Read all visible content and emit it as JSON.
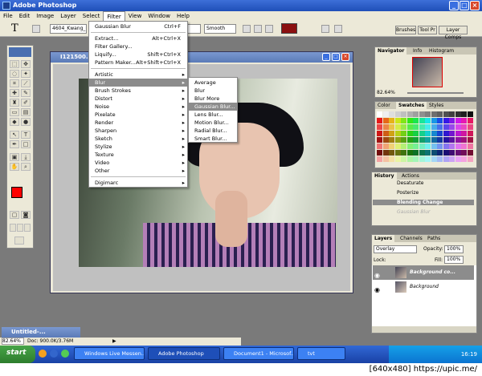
{
  "app_title": "Adobe Photoshop",
  "menu": [
    "File",
    "Edit",
    "Image",
    "Layer",
    "Select",
    "Filter",
    "View",
    "Window",
    "Help"
  ],
  "options": {
    "tool_glyph": "T",
    "font_field": "4604_Kwang_MD",
    "antialias": "Smooth"
  },
  "palette_well": [
    "Brushes",
    "Tool Pr",
    "Layer Comps"
  ],
  "document": {
    "title": "I121500...                  py, RGB/8#)"
  },
  "filter_menu": [
    {
      "label": "Gaussian Blur",
      "shortcut": "Ctrl+F"
    },
    {
      "sep": true
    },
    {
      "label": "Extract...",
      "shortcut": "Alt+Ctrl+X"
    },
    {
      "label": "Filter Gallery...",
      "shortcut": ""
    },
    {
      "label": "Liquify...",
      "shortcut": "Shift+Ctrl+X"
    },
    {
      "label": "Pattern Maker...",
      "shortcut": "Alt+Shift+Ctrl+X"
    },
    {
      "sep": true
    },
    {
      "label": "Artistic",
      "sub": true
    },
    {
      "label": "Blur",
      "sub": true,
      "hl": true
    },
    {
      "label": "Brush Strokes",
      "sub": true
    },
    {
      "label": "Distort",
      "sub": true
    },
    {
      "label": "Noise",
      "sub": true
    },
    {
      "label": "Pixelate",
      "sub": true
    },
    {
      "label": "Render",
      "sub": true
    },
    {
      "label": "Sharpen",
      "sub": true
    },
    {
      "label": "Sketch",
      "sub": true
    },
    {
      "label": "Stylize",
      "sub": true
    },
    {
      "label": "Texture",
      "sub": true
    },
    {
      "label": "Video",
      "sub": true
    },
    {
      "label": "Other",
      "sub": true
    },
    {
      "sep": true
    },
    {
      "label": "Digimarc",
      "sub": true
    }
  ],
  "blur_menu": [
    {
      "label": "Average"
    },
    {
      "label": "Blur"
    },
    {
      "label": "Blur More"
    },
    {
      "label": "Gaussian Blur...",
      "hl": true
    },
    {
      "label": "Lens Blur..."
    },
    {
      "label": "Motion Blur..."
    },
    {
      "label": "Radial Blur..."
    },
    {
      "label": "Smart Blur..."
    }
  ],
  "navigator": {
    "tabs": [
      "Navigator",
      "Info",
      "Histogram"
    ],
    "zoom": "82.64%"
  },
  "swatches": {
    "tabs": [
      "Color",
      "Swatches",
      "Styles"
    ]
  },
  "history": {
    "tabs": [
      "History",
      "Actions"
    ],
    "items": [
      "Desaturate",
      "Posterize",
      "Blending Change",
      "Gaussian Blur"
    ]
  },
  "layers": {
    "tabs": [
      "Layers",
      "Channels",
      "Paths"
    ],
    "blend": "Overlay",
    "opacity_label": "Opacity:",
    "opacity": "100%",
    "lock_label": "Lock:",
    "fill_label": "Fill:",
    "fill": "100%",
    "items": [
      "Background co...",
      "Background"
    ]
  },
  "untitled_doc": "Untitled-...",
  "status": {
    "zoom": "82.64%",
    "doc": "Doc: 900.0K/3.76M"
  },
  "taskbar": {
    "start": "start",
    "tasks": [
      "Windows Live Messen...",
      "Adobe Photoshop",
      "Document1 - Microsof...",
      "tvt"
    ],
    "clock": "16:19"
  },
  "footer": "[640x480] https://upic.me/",
  "colors": {
    "foreground": "#ff0000",
    "accent": "#0a246a"
  }
}
